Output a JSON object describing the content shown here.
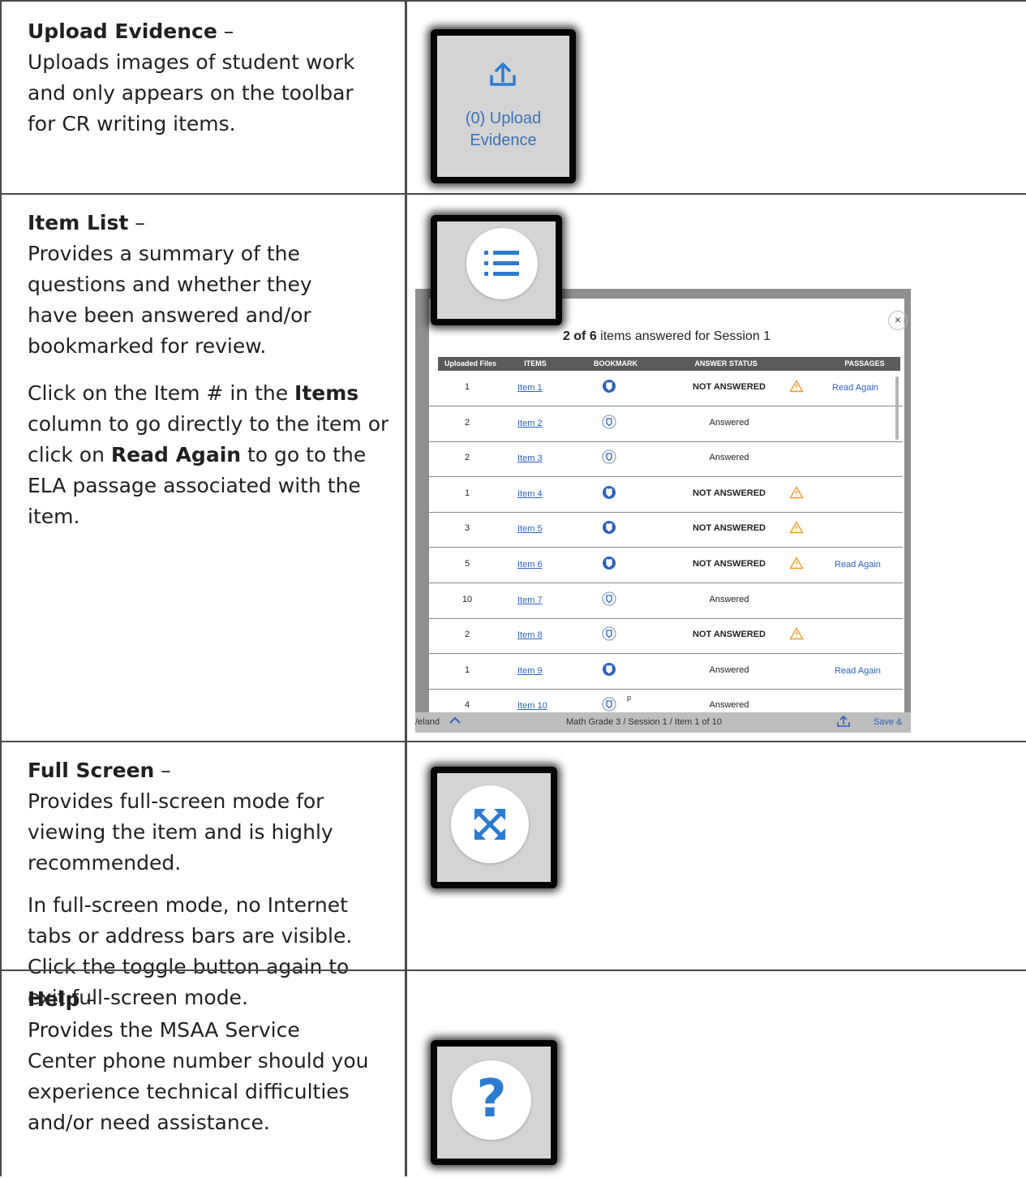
{
  "rows": [
    {
      "title": "Upload Evidence",
      "dash": " –",
      "lines": [
        "Uploads images of student work",
        "and only appears on the toolbar",
        "for CR writing items."
      ],
      "tile": {
        "icon": "upload-icon",
        "label_line1": "(0) Upload",
        "label_line2": "Evidence"
      }
    },
    {
      "title": "Item List",
      "dash": " –",
      "p1_lines": [
        "Provides a summary of the",
        "questions and whether they",
        "have been answered and/or",
        "bookmarked for review."
      ],
      "p2": {
        "a": "Click on the Item # in the ",
        "b": "Items",
        "c": " column to go directly to the item or click on ",
        "d": "Read Again",
        "e": " to go to the ELA passage associated with the item."
      },
      "tile": {
        "icon": "list-icon"
      }
    },
    {
      "title": "Full Screen",
      "dash": " –",
      "p1_lines": [
        "Provides full-screen mode for",
        "viewing the item and is highly",
        "recommended."
      ],
      "p2_lines": [
        "In full-screen mode, no Internet",
        "tabs or address bars are visible.",
        "Click the toggle button again to",
        "exit full-screen mode."
      ],
      "tile": {
        "icon": "fullscreen-icon"
      }
    },
    {
      "title": "Help",
      "dash": " –",
      "lines": [
        "Provides the MSAA Service",
        "Center phone number should you",
        "experience technical difficulties",
        "and/or need assistance."
      ],
      "tile": {
        "icon": "help-icon",
        "glyph": "?"
      }
    }
  ],
  "item_list_popup": {
    "close_glyph": "×",
    "summary_bold": "2 of 6",
    "summary_rest": " items answered for Session 1",
    "headers": [
      "Uploaded Files",
      "ITEMS",
      "BOOKMARK",
      "ANSWER STATUS",
      "PASSAGES"
    ],
    "rows": [
      {
        "files": "1",
        "item": "Item 1",
        "bookmarked": true,
        "status": "NOT ANSWERED",
        "warning": true,
        "passage": "Read Again"
      },
      {
        "files": "2",
        "item": "Item 2",
        "bookmarked": false,
        "status": "Answered",
        "warning": false,
        "passage": ""
      },
      {
        "files": "2",
        "item": "Item 3",
        "bookmarked": false,
        "status": "Answered",
        "warning": false,
        "passage": ""
      },
      {
        "files": "1",
        "item": "Item 4",
        "bookmarked": true,
        "status": "NOT ANSWERED",
        "warning": true,
        "passage": ""
      },
      {
        "files": "3",
        "item": "Item 5",
        "bookmarked": true,
        "status": "NOT ANSWERED",
        "warning": true,
        "passage": ""
      },
      {
        "files": "5",
        "item": "Item 6",
        "bookmarked": true,
        "status": "NOT ANSWERED",
        "warning": true,
        "passage": "Read Again"
      },
      {
        "files": "10",
        "item": "Item 7",
        "bookmarked": false,
        "status": "Answered",
        "warning": false,
        "passage": ""
      },
      {
        "files": "2",
        "item": "Item 8",
        "bookmarked": false,
        "status": "NOT ANSWERED",
        "warning": true,
        "passage": ""
      },
      {
        "files": "1",
        "item": "Item 9",
        "bookmarked": true,
        "status": "Answered",
        "warning": false,
        "passage": "Read Again"
      },
      {
        "files": "4",
        "item": "Item 10",
        "bookmarked": false,
        "status": "Answered",
        "warning": false,
        "passage": ""
      }
    ],
    "floating_letter": "p",
    "footer": {
      "left_label": "/eland",
      "breadcrumb": "Math Grade 3  /  Session 1  /  Item 1 of 10",
      "save_label": "Save &"
    }
  },
  "colors": {
    "accent_blue": "#2b7bd0",
    "link_blue": "#2b62bf",
    "warning_orange": "#f29a2e",
    "tile_gray": "#d4d4d4"
  }
}
